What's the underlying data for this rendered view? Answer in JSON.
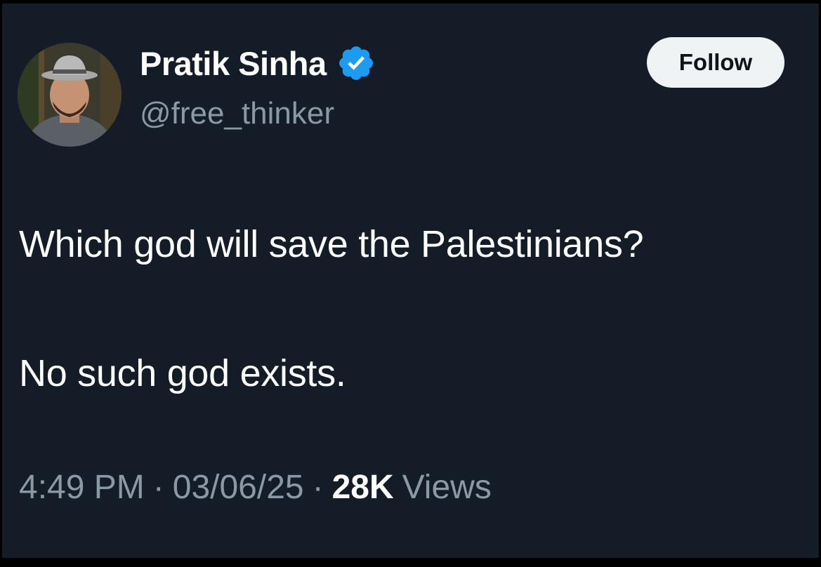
{
  "author": {
    "display_name": "Pratik Sinha",
    "handle": "@free_thinker",
    "verified": true
  },
  "follow_label": "Follow",
  "tweet": {
    "line1": "Which god will save the Palestinians?",
    "line2": "No such god exists."
  },
  "meta": {
    "time": "4:49 PM",
    "separator": "·",
    "date": "03/06/25",
    "views_count": "28K",
    "views_label": "Views"
  },
  "colors": {
    "background": "#141c28",
    "text_primary": "#ffffff",
    "text_secondary": "#8b98a5",
    "verified_badge": "#1d9bf0",
    "follow_button_bg": "#eff3f4"
  },
  "icons": {
    "verified": "verified-badge-icon",
    "avatar": "profile-photo"
  }
}
